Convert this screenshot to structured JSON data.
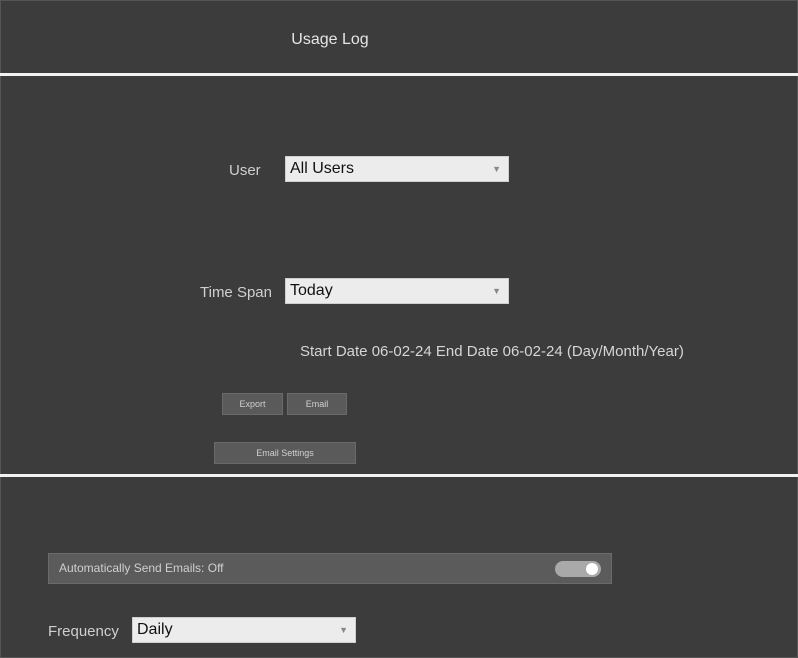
{
  "header": {
    "title": "Usage Log"
  },
  "user": {
    "label": "User",
    "selected": "All Users"
  },
  "timespan": {
    "label": "Time Span",
    "selected": "Today"
  },
  "dates": {
    "text": "Start Date 06-02-24 End Date 06-02-24 (Day/Month/Year)"
  },
  "buttons": {
    "export": "Export",
    "email": "Email",
    "email_settings": "Email Settings"
  },
  "auto_email": {
    "label": "Automatically Send Emails: Off",
    "enabled": true
  },
  "frequency": {
    "label": "Frequency",
    "selected": "Daily"
  },
  "colors": {
    "background": "#3c3c3c",
    "divider": "#f2f2f2",
    "input": "#ececec",
    "button": "#5a5a5a"
  }
}
